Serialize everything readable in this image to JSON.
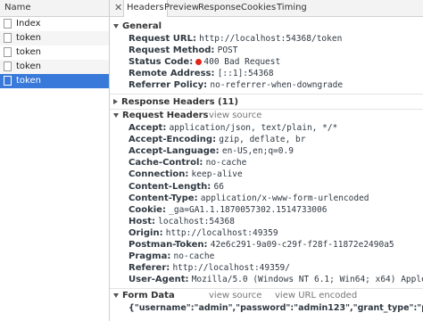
{
  "left": {
    "header": "Name",
    "requests": [
      {
        "name": "Index",
        "selected": false
      },
      {
        "name": "token",
        "selected": false
      },
      {
        "name": "token",
        "selected": false
      },
      {
        "name": "token",
        "selected": false
      },
      {
        "name": "token",
        "selected": true
      }
    ]
  },
  "tabs": [
    "Headers",
    "Preview",
    "Response",
    "Cookies",
    "Timing"
  ],
  "active_tab": "Headers",
  "general": {
    "title": "General",
    "request_url": {
      "k": "Request URL:",
      "v": "http://localhost:54368/token"
    },
    "request_method": {
      "k": "Request Method:",
      "v": "POST"
    },
    "status_code": {
      "k": "Status Code:",
      "v": "400 Bad Request"
    },
    "remote_address": {
      "k": "Remote Address:",
      "v": "[::1]:54368"
    },
    "referrer_policy": {
      "k": "Referrer Policy:",
      "v": "no-referrer-when-downgrade"
    }
  },
  "response_headers": {
    "title": "Response Headers (11)"
  },
  "request_headers": {
    "title": "Request Headers",
    "view_source": "view source",
    "items": [
      {
        "k": "Accept:",
        "v": "application/json, text/plain, */*"
      },
      {
        "k": "Accept-Encoding:",
        "v": "gzip, deflate, br"
      },
      {
        "k": "Accept-Language:",
        "v": "en-US,en;q=0.9"
      },
      {
        "k": "Cache-Control:",
        "v": "no-cache"
      },
      {
        "k": "Connection:",
        "v": "keep-alive"
      },
      {
        "k": "Content-Length:",
        "v": "66"
      },
      {
        "k": "Content-Type:",
        "v": "application/x-www-form-urlencoded"
      },
      {
        "k": "Cookie:",
        "v": "_ga=GA1.1.1870057302.1514733006"
      },
      {
        "k": "Host:",
        "v": "localhost:54368"
      },
      {
        "k": "Origin:",
        "v": "http://localhost:49359"
      },
      {
        "k": "Postman-Token:",
        "v": "42e6c291-9a09-c29f-f28f-11872e2490a5"
      },
      {
        "k": "Pragma:",
        "v": "no-cache"
      },
      {
        "k": "Referer:",
        "v": "http://localhost:49359/"
      },
      {
        "k": "User-Agent:",
        "v": "Mozilla/5.0 (Windows NT 6.1; Win64; x64) AppleWebKit/5"
      }
    ]
  },
  "form_data": {
    "title": "Form Data",
    "view_source": "view source",
    "view_url_encoded": "view URL encoded",
    "value": "{\"username\":\"admin\",\"password\":\"admin123\",\"grant_type\":\"password\"}:"
  },
  "colors": {
    "selected_row": "#3879d9",
    "status_error": "#e0251a"
  },
  "icons": {
    "close": "close-icon",
    "file": "file-icon",
    "expand": "triangle-icon"
  }
}
